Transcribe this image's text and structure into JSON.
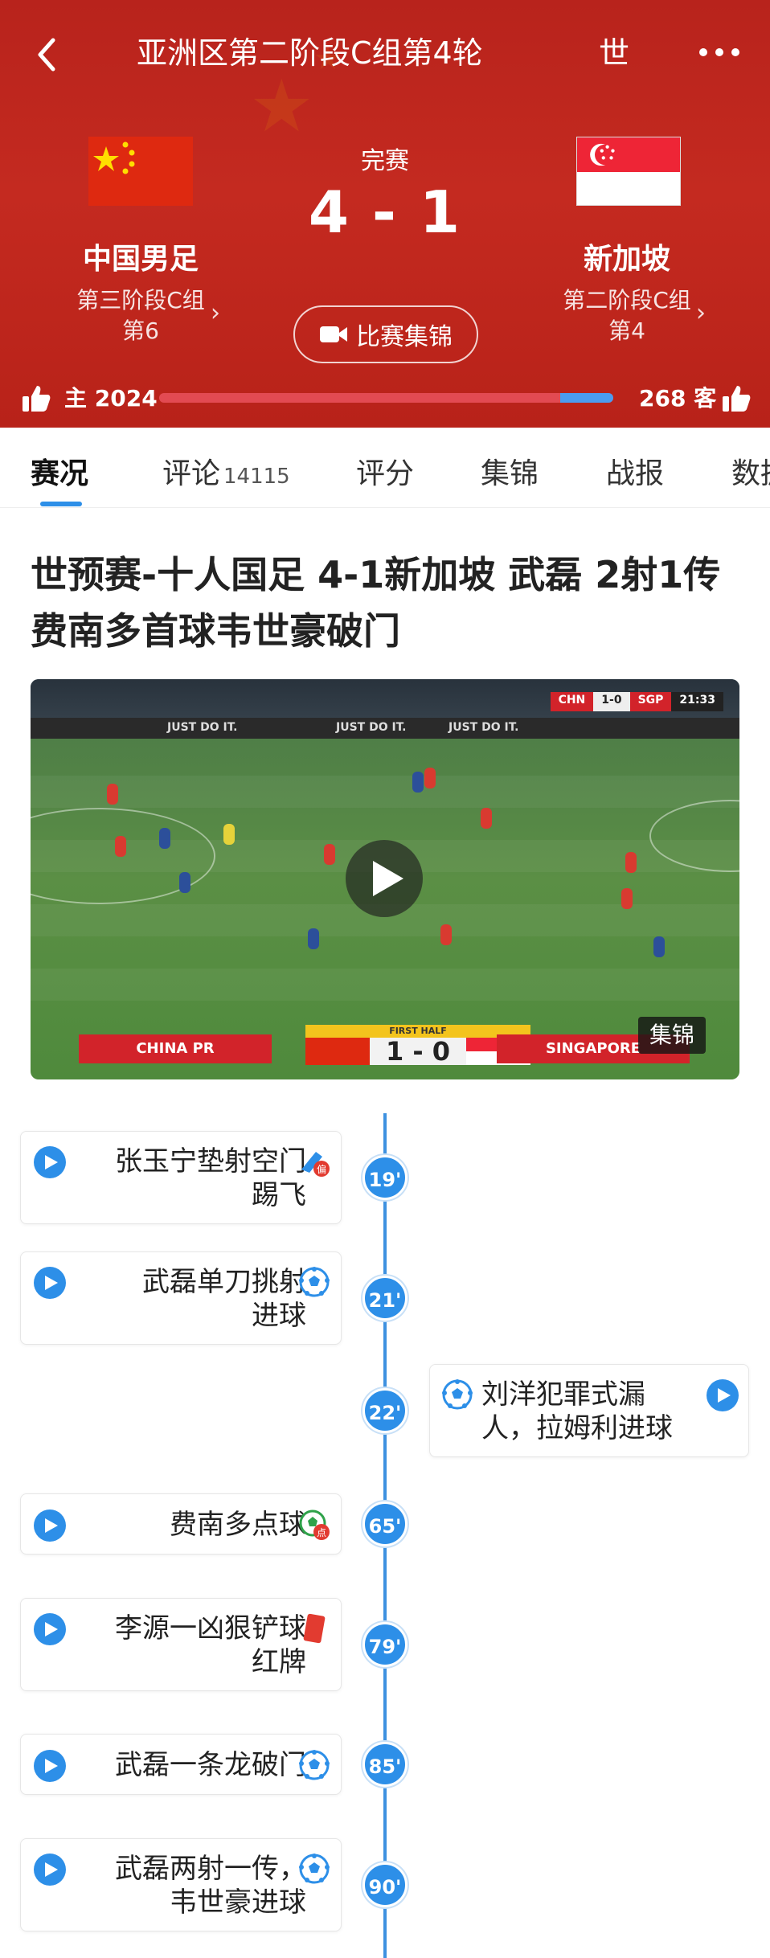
{
  "header": {
    "title": "亚洲区第二阶段C组第4轮",
    "title_right": "世",
    "status": "完赛",
    "score": "4 - 1",
    "highlights_label": "比赛集锦",
    "home": {
      "name": "中国男足",
      "group": "第三阶段C组",
      "rank": "第6"
    },
    "away": {
      "name": "新加坡",
      "group": "第二阶段C组",
      "rank": "第4"
    },
    "vote": {
      "home_label": "主 2024",
      "away_label": "268 客",
      "home_votes": 2024,
      "away_votes": 268
    }
  },
  "tabs": [
    {
      "label": "赛况",
      "active": true
    },
    {
      "label": "评论",
      "count": "14115"
    },
    {
      "label": "评分"
    },
    {
      "label": "集锦"
    },
    {
      "label": "战报"
    },
    {
      "label": "数据"
    }
  ],
  "article": {
    "headline": "世预赛-十人国足 4-1新加坡 武磊 2射1传费南多首球韦世豪破门",
    "video": {
      "tag": "集锦",
      "top_score": {
        "home": "CHN",
        "score": "1-0",
        "away": "SGP",
        "clock": "21:33"
      },
      "bug": {
        "home": "CHINA PR",
        "half": "FIRST HALF",
        "score": "1 - 0",
        "away": "SINGAPORE"
      },
      "ads": [
        "JUST DO IT.",
        "JUST DO IT.",
        "JUST DO IT."
      ]
    }
  },
  "timeline": [
    {
      "minute": "19'",
      "side": "left",
      "text": "张玉宁垫射空门\n踢飞",
      "event_icon": "shot-off-target-icon"
    },
    {
      "minute": "21'",
      "side": "left",
      "text": "武磊单刀挑射\n进球",
      "event_icon": "goal-ball-icon"
    },
    {
      "minute": "22'",
      "side": "right",
      "text": "刘洋犯罪式漏\n人，拉姆利进球",
      "event_icon": "goal-ball-icon"
    },
    {
      "minute": "65'",
      "side": "left",
      "text": "费南多点球",
      "event_icon": "penalty-goal-icon"
    },
    {
      "minute": "79'",
      "side": "left",
      "text": "李源一凶狠铲球\n红牌",
      "event_icon": "red-card-icon"
    },
    {
      "minute": "85'",
      "side": "left",
      "text": "武磊一条龙破门",
      "event_icon": "goal-ball-icon"
    },
    {
      "minute": "90'",
      "side": "left",
      "text": "武磊两射一传，\n韦世豪进球",
      "event_icon": "goal-ball-icon"
    }
  ],
  "colors": {
    "header_red": "#c42a20",
    "accent_blue": "#2d8fe8",
    "home_bar": "#e24a52",
    "away_bar": "#4b9cf0"
  }
}
